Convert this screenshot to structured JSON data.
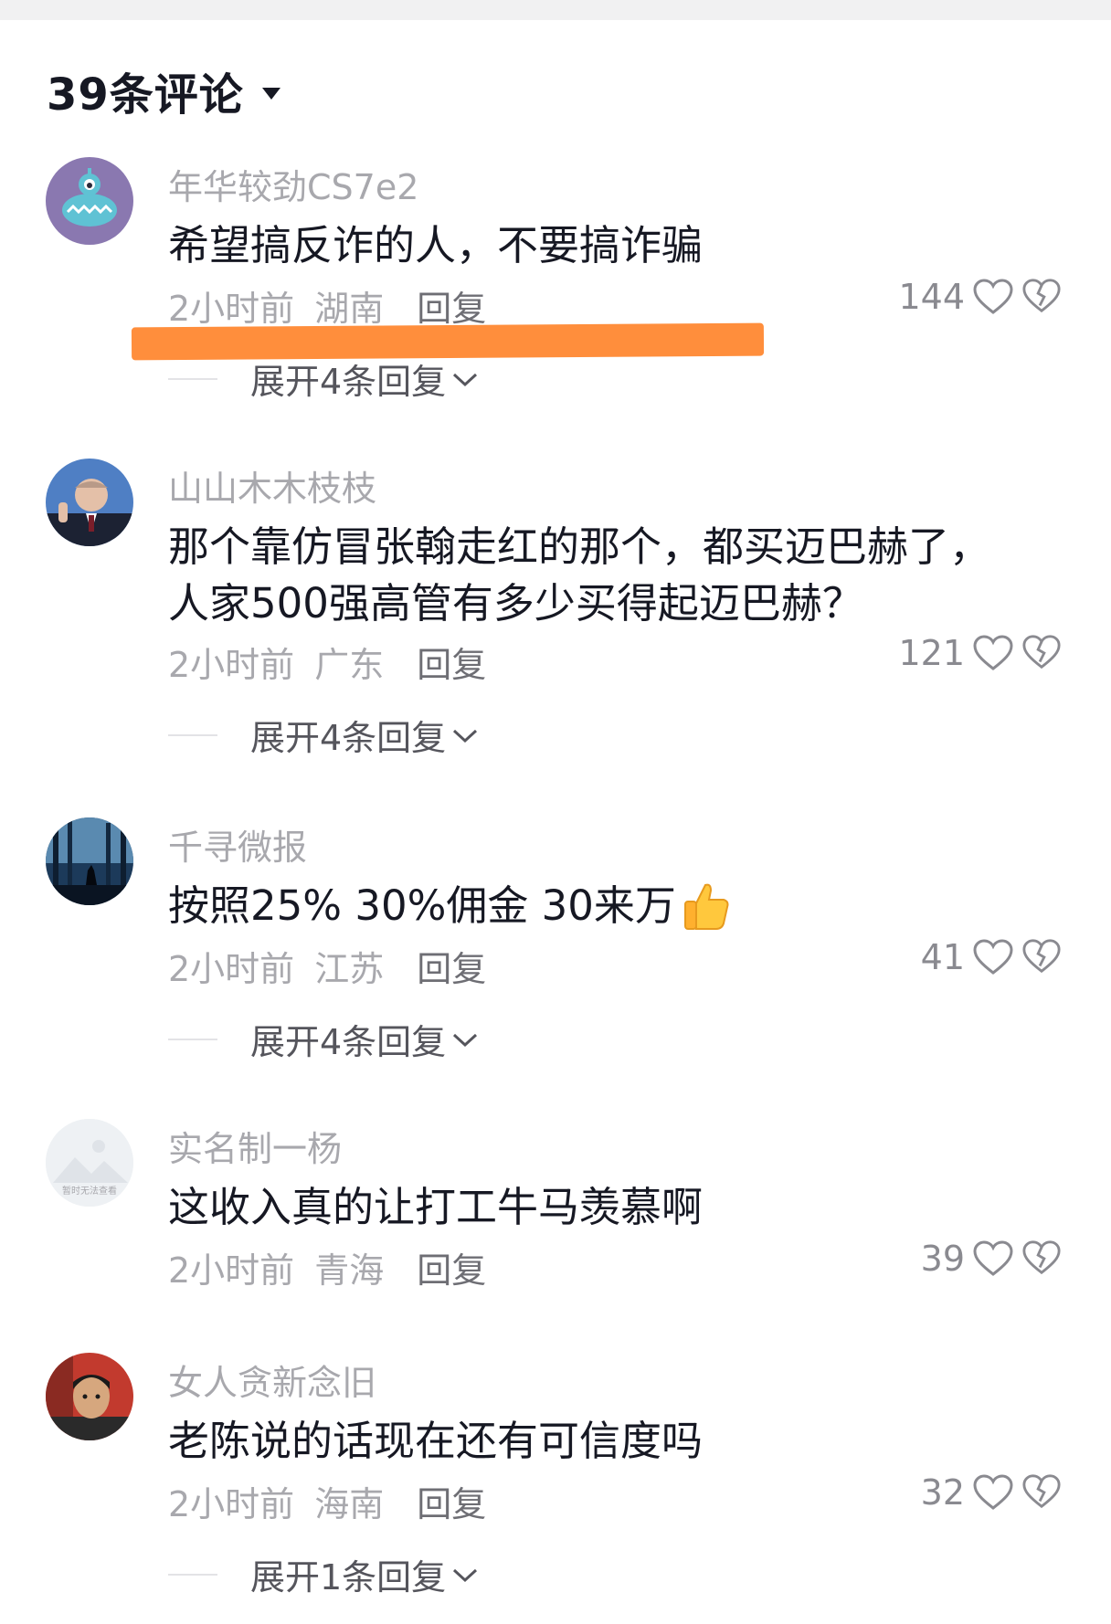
{
  "header": {
    "title": "39条评论"
  },
  "comments": [
    {
      "username": "年华较劲CS7e2",
      "text": [
        "希望搞反诈的人，不要搞诈骗"
      ],
      "time": "2小时前",
      "location": "湖南",
      "reply": "回复",
      "likes": "144",
      "expand": "展开4条回复"
    },
    {
      "username": "山山木木枝枝",
      "text": [
        "那个靠仿冒张翰走红的那个，都买迈巴赫了，",
        "人家500强高管有多少买得起迈巴赫？"
      ],
      "time": "2小时前",
      "location": "广东",
      "reply": "回复",
      "likes": "121",
      "expand": "展开4条回复"
    },
    {
      "username": "千寻微报",
      "text": [
        "按照25% 30%佣金 30来万"
      ],
      "time": "2小时前",
      "location": "江苏",
      "reply": "回复",
      "likes": "41",
      "expand": "展开4条回复"
    },
    {
      "username": "实名制一杨",
      "text": [
        "这收入真的让打工牛马羡慕啊"
      ],
      "time": "2小时前",
      "location": "青海",
      "reply": "回复",
      "likes": "39",
      "expand": ""
    },
    {
      "username": "女人贪新念旧",
      "text": [
        "老陈说的话现在还有可信度吗"
      ],
      "time": "2小时前",
      "location": "海南",
      "reply": "回复",
      "likes": "32",
      "expand": "展开1条回复"
    }
  ],
  "avatar_placeholder_text": "暂时无法查看",
  "icons": {
    "like": "heart-outline-icon",
    "dislike": "broken-heart-icon",
    "caret": "caret-down-icon",
    "expand": "chevron-down-icon",
    "thumb": "thumbs-up-emoji"
  },
  "colors": {
    "highlight": "#ff8e3c",
    "muted": "#a8a8ad",
    "text": "#161823"
  }
}
